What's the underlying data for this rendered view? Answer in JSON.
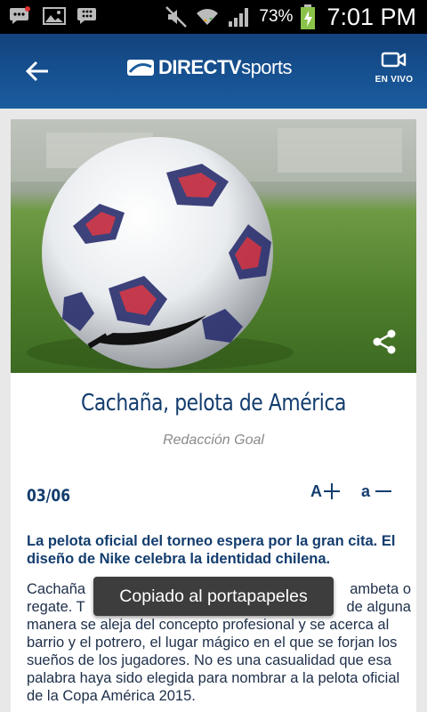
{
  "status_bar": {
    "battery_percent": "73%",
    "time": "7:01 PM",
    "icons": [
      "bbm-chat-icon",
      "gallery-icon",
      "blackberry-icon",
      "mute-icon",
      "wifi-icon",
      "signal-icon",
      "battery-charging-icon"
    ]
  },
  "app_bar": {
    "logo_bold": "DIRECTV",
    "logo_light": "sports",
    "live_label": "EN VIVO",
    "color": "#1a5c9f"
  },
  "article": {
    "title": "Cachaña, pelota de América",
    "author": "Redacción Goal",
    "date": "03/06",
    "font_increase_label": "A",
    "font_decrease_label": "a",
    "lead": "La pelota oficial del torneo espera por la gran cita. El diseño de Nike celebra la identidad chilena.",
    "body_line_1_start": "Cachaña",
    "body_line_1_end": "ambeta o",
    "body_line_2_start": "regate. T",
    "body_line_2_end": "de alguna",
    "body_rest": "manera se aleja del concepto profesional y se acerca al barrio y el potrero, el lugar mágico en el que se forjan los sueños de los jugadores. No es una casualidad que esa palabra haya sido elegida para nombrar a la pelota oficial de la Copa América 2015."
  },
  "toast": {
    "message": "Copiado al portapapeles"
  }
}
